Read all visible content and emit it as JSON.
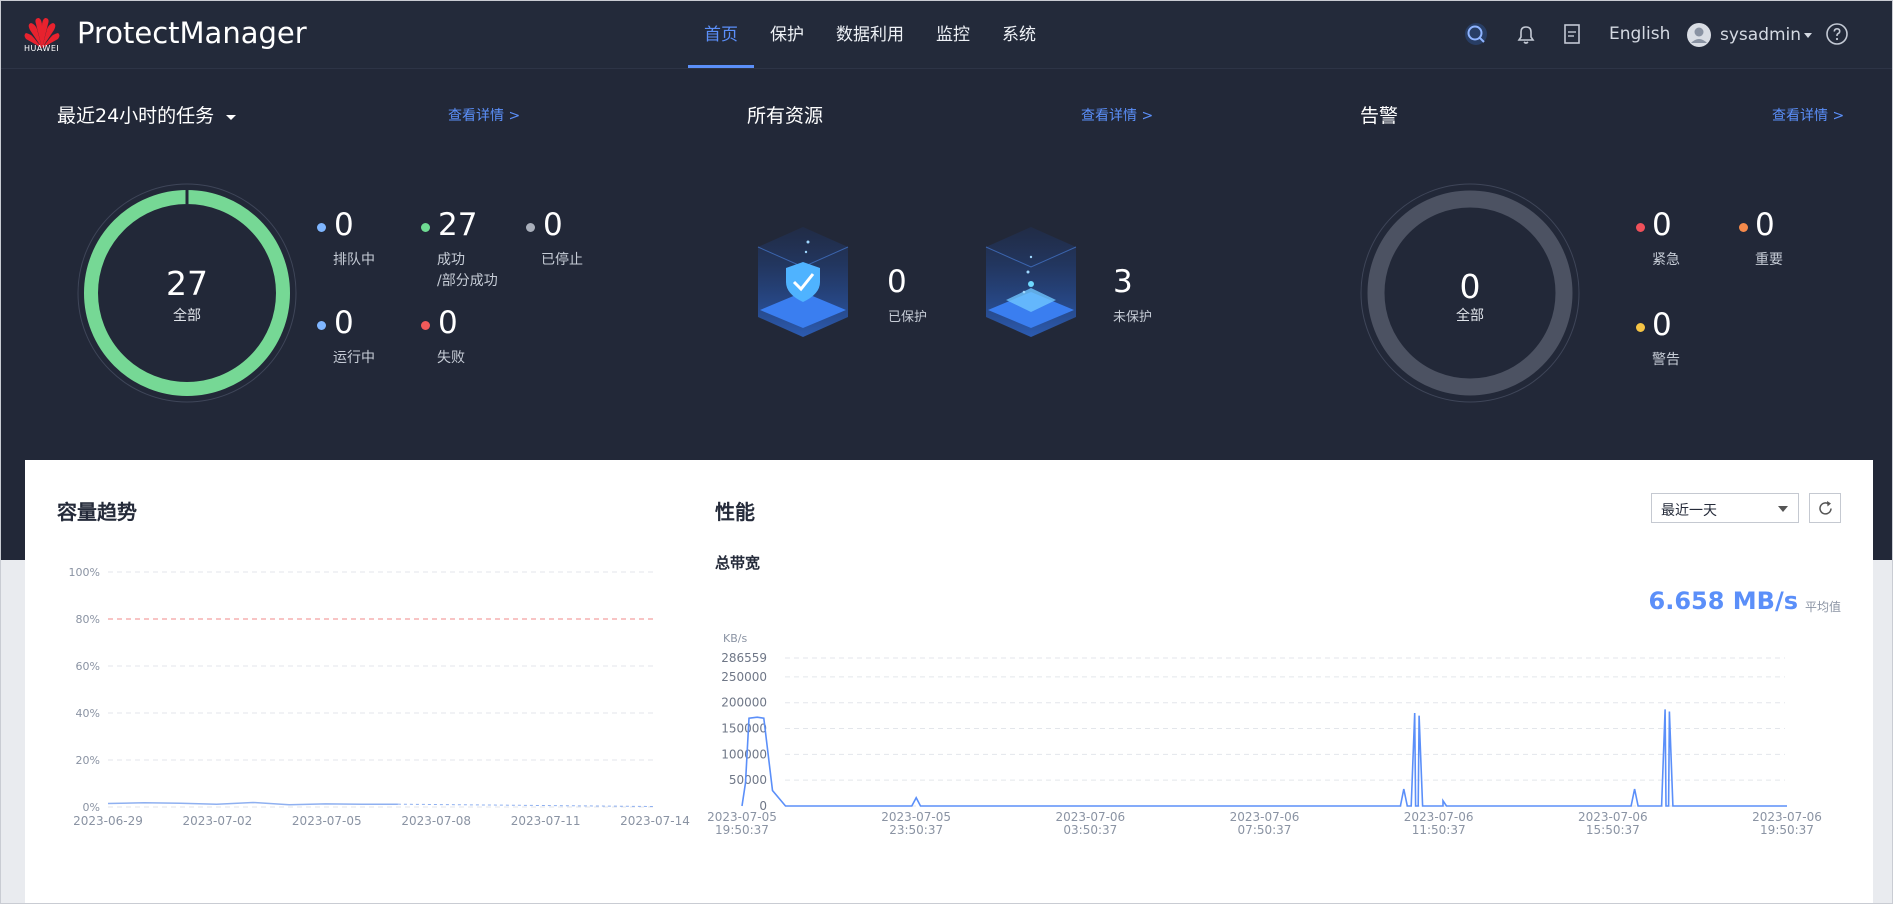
{
  "header": {
    "logo_text": "HUAWEI",
    "brand": "ProtectManager",
    "nav": [
      "首页",
      "保护",
      "数据利用",
      "监控",
      "系统"
    ],
    "active_nav": 0,
    "language": "English",
    "username": "sysadmin",
    "icons": [
      "search-icon",
      "bell-icon",
      "document-icon",
      "user-avatar-icon",
      "help-icon"
    ]
  },
  "tasks": {
    "title": "最近24小时的任务",
    "detail_link": "查看详情 >",
    "total": "27",
    "total_label": "全部",
    "stats": [
      {
        "value": "0",
        "label": "排队中",
        "color": "#7fb6ff"
      },
      {
        "value": "27",
        "label": "成功",
        "label2": "/部分成功",
        "color": "#6fdb93"
      },
      {
        "value": "0",
        "label": "已停止",
        "color": "#a9afbb"
      },
      {
        "value": "0",
        "label": "运行中",
        "color": "#7fb6ff"
      },
      {
        "value": "0",
        "label": "失败",
        "color": "#f05a5a"
      }
    ]
  },
  "resources": {
    "title": "所有资源",
    "detail_link": "查看详情 >",
    "protected_value": "0",
    "protected_label": "已保护",
    "unprotected_value": "3",
    "unprotected_label": "未保护"
  },
  "alarms": {
    "title": "告警",
    "detail_link": "查看详情 >",
    "total": "0",
    "total_label": "全部",
    "stats": [
      {
        "value": "0",
        "label": "紧急",
        "color": "#f0505a"
      },
      {
        "value": "0",
        "label": "重要",
        "color": "#f58a4b"
      },
      {
        "value": "0",
        "label": "警告",
        "color": "#f6c445"
      }
    ]
  },
  "capacity": {
    "title": "容量趋势"
  },
  "performance": {
    "title": "性能",
    "subtitle": "总带宽",
    "range_select": "最近一天",
    "average_value": "6.658 MB/s",
    "average_label": "平均值"
  },
  "chart_data": [
    {
      "type": "line",
      "title": "容量趋势",
      "y_ticks": [
        "100%",
        "80%",
        "60%",
        "40%",
        "20%",
        "0%"
      ],
      "x_ticks": [
        "2023-06-29",
        "2023-07-02",
        "2023-07-05",
        "2023-07-08",
        "2023-07-11",
        "2023-07-14"
      ],
      "threshold": 80,
      "ylim": [
        0,
        100
      ],
      "series": [
        {
          "x": [
            0,
            1,
            2,
            3,
            4,
            5,
            6,
            7,
            8
          ],
          "values": [
            1.5,
            1.8,
            1.6,
            1.2,
            1.9,
            1.0,
            1.3,
            1.2,
            1.2
          ]
        }
      ],
      "grid": true
    },
    {
      "type": "line",
      "title": "总带宽",
      "ylabel": "KB/s",
      "y_ticks": [
        "286559",
        "250000",
        "200000",
        "150000",
        "100000",
        "50000",
        "0"
      ],
      "ylim": [
        0,
        286559
      ],
      "x_ticks": [
        [
          "2023-07-05",
          "19:50:37"
        ],
        [
          "2023-07-05",
          "23:50:37"
        ],
        [
          "2023-07-06",
          "03:50:37"
        ],
        [
          "2023-07-06",
          "07:50:37"
        ],
        [
          "2023-07-06",
          "11:50:37"
        ],
        [
          "2023-07-06",
          "15:50:37"
        ],
        [
          "2023-07-06",
          "19:50:37"
        ]
      ],
      "series": [
        {
          "x": [
            0,
            0.08,
            0.16,
            0.35,
            0.5,
            0.7,
            1.0,
            3.9,
            4.0,
            4.1,
            12.4,
            12.52,
            12.6,
            12.75,
            13.0,
            16.0,
            16.1,
            16.25,
            16.4,
            16.6,
            16.75,
            17.0,
            17.2,
            17.5,
            17.6,
            17.75,
            17.9,
            18.05,
            18.2,
            18.35,
            18.5,
            18.7,
            21.5,
            21.6,
            21.75,
            21.9,
            22.0,
            22.15,
            22.35,
            22.5,
            22.7,
            24.0
          ],
          "values": [
            0,
            45000,
            170000,
            172000,
            170000,
            30000,
            0,
            0,
            16000,
            0,
            0,
            0,
            0,
            0,
            0,
            0,
            0,
            0,
            0,
            0,
            0,
            0,
            0,
            0,
            0,
            0,
            0,
            0,
            0,
            0,
            0,
            0,
            0,
            0,
            0,
            0,
            0,
            0,
            0,
            0,
            0,
            0
          ]
        }
      ],
      "peaks": [
        {
          "x": 15.2,
          "value": 33000
        },
        {
          "x": 15.45,
          "value": 180000
        },
        {
          "x": 15.55,
          "value": 175000
        },
        {
          "x": 16.1,
          "value": 10000
        },
        {
          "x": 20.5,
          "value": 33000
        },
        {
          "x": 21.2,
          "value": 187000
        },
        {
          "x": 21.3,
          "value": 183000
        }
      ],
      "grid": true
    }
  ]
}
